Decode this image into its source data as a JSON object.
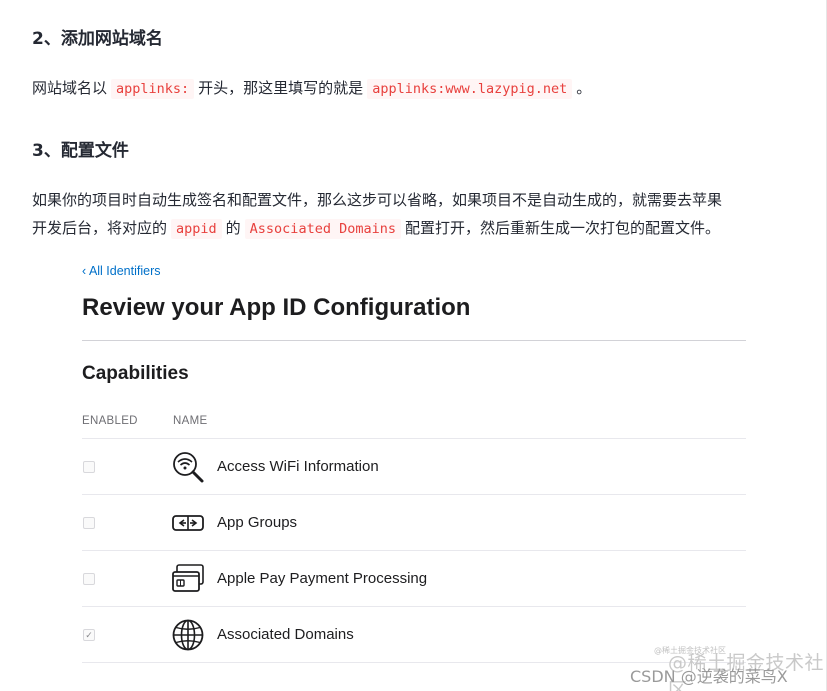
{
  "section2": {
    "heading": "2、添加网站域名",
    "text_before": "网站域名以",
    "code_prefix": "applinks:",
    "text_middle": "开头，那这里填写的就是",
    "code_value": "applinks:www.lazypig.net",
    "text_after": "。"
  },
  "section3": {
    "heading": "3、配置文件",
    "text_line1": "如果你的项目时自动生成签名和配置文件，那么这步可以省略，如果项目不是自动生成的，就需要去苹果",
    "text_line2_before": "开发后台，将对应的",
    "code_appid": "appid",
    "text_line2_mid": "的",
    "code_domains": "Associated Domains",
    "text_line2_after": "配置打开，然后重新生成一次打包的配置文件。"
  },
  "screenshot": {
    "back_link": "‹ All Identifiers",
    "title": "Review your App ID Configuration",
    "capabilities_title": "Capabilities",
    "col_enabled": "ENABLED",
    "col_name": "NAME",
    "rows": [
      {
        "label": "Access WiFi Information",
        "icon": "wifi-search-icon",
        "checked": false
      },
      {
        "label": "App Groups",
        "icon": "app-groups-icon",
        "checked": false
      },
      {
        "label": "Apple Pay Payment Processing",
        "icon": "apple-pay-card-icon",
        "checked": false
      },
      {
        "label": "Associated Domains",
        "icon": "globe-icon",
        "checked": true
      }
    ],
    "check_mark": "✓"
  },
  "watermark": {
    "small": "@稀土掘金技术社区",
    "large": "@稀土掘金技术社区",
    "csdn": "CSDN @逆袭的菜鸟X"
  }
}
